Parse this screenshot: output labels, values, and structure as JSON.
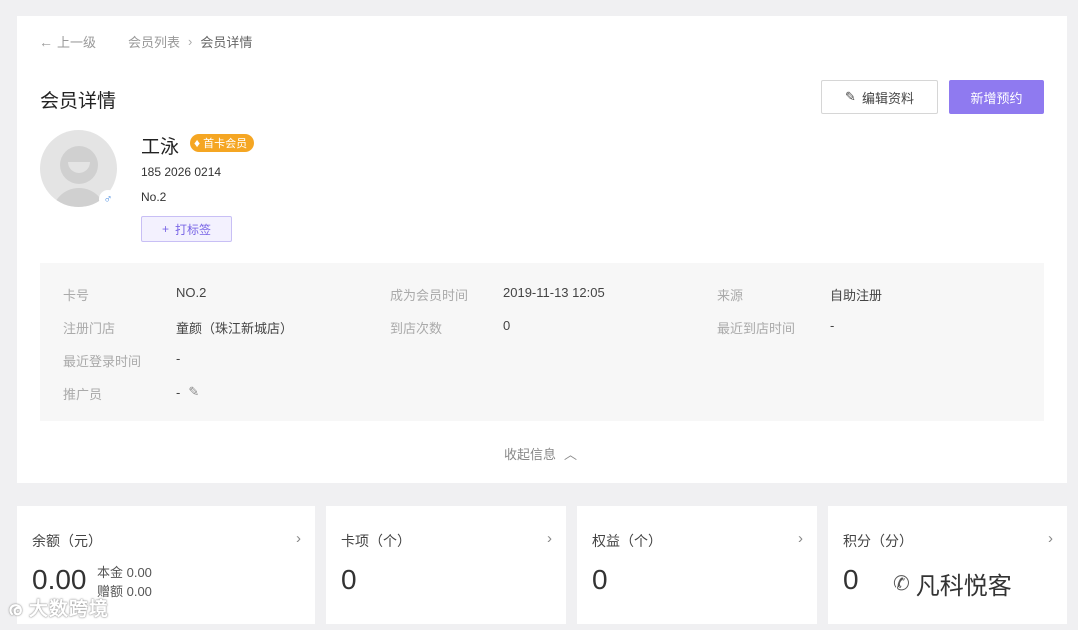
{
  "breadcrumb": {
    "back_label": "上一级",
    "items": [
      "会员列表",
      "会员详情"
    ]
  },
  "page_title": "会员详情",
  "actions": {
    "edit_label": "编辑资料",
    "new_label": "新增预约"
  },
  "member": {
    "name": "工泳",
    "badge": "首卡会员",
    "phone": "185 2026 0214",
    "no": "No.2",
    "gender_icon": "♂",
    "tag_button": "打标签"
  },
  "info": {
    "card_no_label": "卡号",
    "card_no": "NO.2",
    "join_time_label": "成为会员时间",
    "join_time": "2019-11-13 12:05",
    "source_label": "来源",
    "source": "自助注册",
    "store_label": "注册门店",
    "store": "童颜（珠江新城店）",
    "visits_label": "到店次数",
    "visits": "0",
    "last_visit_label": "最近到店时间",
    "last_visit": "-",
    "last_login_label": "最近登录时间",
    "last_login": "-",
    "promoter_label": "推广员",
    "promoter": "-"
  },
  "collapse_label": "收起信息",
  "stats": {
    "balance": {
      "title": "余额（元）",
      "value": "0.00",
      "principal": "本金 0.00",
      "gift": "赠额 0.00"
    },
    "card_items": {
      "title": "卡项（个）",
      "value": "0"
    },
    "rights": {
      "title": "权益（个）",
      "value": "0"
    },
    "points": {
      "title": "积分（分）",
      "value": "0"
    }
  },
  "watermarks": {
    "left": "大数跨境",
    "right": "凡科悦客"
  },
  "colors": {
    "accent": "#8f7af0",
    "badge": "#f5a623",
    "gender": "#4a8de0"
  }
}
